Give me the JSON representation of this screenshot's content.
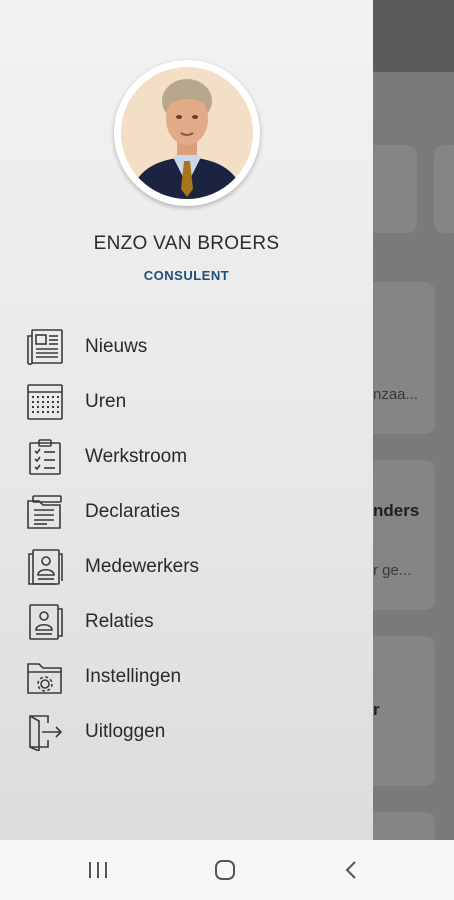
{
  "user": {
    "name": "ENZO VAN BROERS",
    "role": "CONSULENT"
  },
  "menu": [
    {
      "label": "Nieuws"
    },
    {
      "label": "Uren"
    },
    {
      "label": "Werkstroom"
    },
    {
      "label": "Declaraties"
    },
    {
      "label": "Medewerkers"
    },
    {
      "label": "Relaties"
    },
    {
      "label": "Instellingen"
    },
    {
      "label": "Uitloggen"
    }
  ],
  "background": {
    "snippet1": "nzaa...",
    "snippet2": "nders",
    "snippet3": "r ge...",
    "snippet4": "r"
  },
  "colors": {
    "role": "#1f4e79",
    "icon": "#3a3a3a"
  }
}
